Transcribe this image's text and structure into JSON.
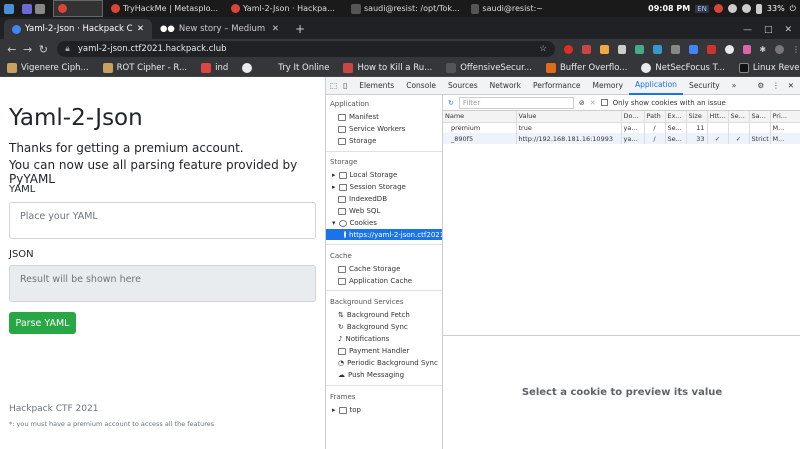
{
  "taskbar": {
    "apps": [
      {
        "label": "",
        "color": "#4a90d9"
      },
      {
        "label": "",
        "color": "#6b6bd6"
      },
      {
        "label": "TryHackMe | Metasplo...",
        "color": "#e8eaed"
      },
      {
        "label": "Yaml-2-Json · Hackpa...",
        "color": "#e8eaed"
      },
      {
        "label": "saudi@resist: /opt/Tok...",
        "color": "#555"
      },
      {
        "label": "saudi@resist:~",
        "color": "#555"
      }
    ],
    "clock": "09:08 PM",
    "lang": "EN",
    "battery": "33%"
  },
  "tabs": [
    {
      "label": "Yaml-2-Json · Hackpack C",
      "active": true
    },
    {
      "label": "New story – Medium",
      "active": false
    }
  ],
  "omnibox": {
    "url": "yaml-2-json.ctf2021.hackpack.club"
  },
  "bookmarks": [
    {
      "label": "Vigenere Ciph...",
      "color": "#c8a060"
    },
    {
      "label": "ROT Cipher - R...",
      "color": "#c8a060"
    },
    {
      "label": "ind",
      "color": "#d44"
    },
    {
      "label": "",
      "color": "#e8eaed"
    },
    {
      "label": "Try It Online",
      "color": "#555"
    },
    {
      "label": "How to Kill a Ru...",
      "color": "#c44"
    },
    {
      "label": "OffensiveSecur...",
      "color": "#333"
    },
    {
      "label": "Buffer Overflo...",
      "color": "#e06c1a"
    },
    {
      "label": "NetSecFocus T...",
      "color": "#e8eaed"
    },
    {
      "label": "Linux Reverse...",
      "color": "#111"
    }
  ],
  "app": {
    "title": "Yaml-2-Json",
    "thanks": "Thanks for getting a premium account.",
    "usage": "You can now use all parsing feature provided by PyYAML",
    "yaml_label": "YAML",
    "yaml_placeholder": "Place your YAML",
    "json_label": "JSON",
    "json_placeholder": "Result will be shown here",
    "parse_button": "Parse YAML",
    "footer_title": "Hackpack CTF 2021",
    "footer_note": "*: you must have a premium account to access all the features"
  },
  "devtools": {
    "tabs": [
      "Elements",
      "Console",
      "Sources",
      "Network",
      "Performance",
      "Memory",
      "Application",
      "Security",
      "»"
    ],
    "active_tab": "Application",
    "sidebar": {
      "application_header": "Application",
      "application_items": [
        "Manifest",
        "Service Workers",
        "Storage"
      ],
      "storage_header": "Storage",
      "storage_items": [
        "Local Storage",
        "Session Storage",
        "IndexedDB",
        "Web SQL",
        "Cookies"
      ],
      "cookie_origin": "https://yaml-2-json.ctf2021...",
      "cache_header": "Cache",
      "cache_items": [
        "Cache Storage",
        "Application Cache"
      ],
      "bg_header": "Background Services",
      "bg_items": [
        "Background Fetch",
        "Background Sync",
        "Notifications",
        "Payment Handler",
        "Periodic Background Sync",
        "Push Messaging"
      ],
      "frames_header": "Frames",
      "frames_items": [
        "top"
      ]
    },
    "filter_placeholder": "Filter",
    "show_issue_label": "Only show cookies with an issue",
    "columns": [
      "Name",
      "Value",
      "Do...",
      "Path",
      "Ex...",
      "Size",
      "Htt...",
      "Se...",
      "Sa...",
      "Pri..."
    ],
    "rows": [
      [
        "premium",
        "true",
        "ya...",
        "/",
        "Se...",
        "11",
        "",
        "",
        "",
        "M..."
      ],
      [
        "_890f5",
        "http://192.168.181.16:10993",
        "ya...",
        "/",
        "Se...",
        "33",
        "✓",
        "✓",
        "Strict",
        "M..."
      ]
    ],
    "preview_text": "Select a cookie to preview its value"
  }
}
